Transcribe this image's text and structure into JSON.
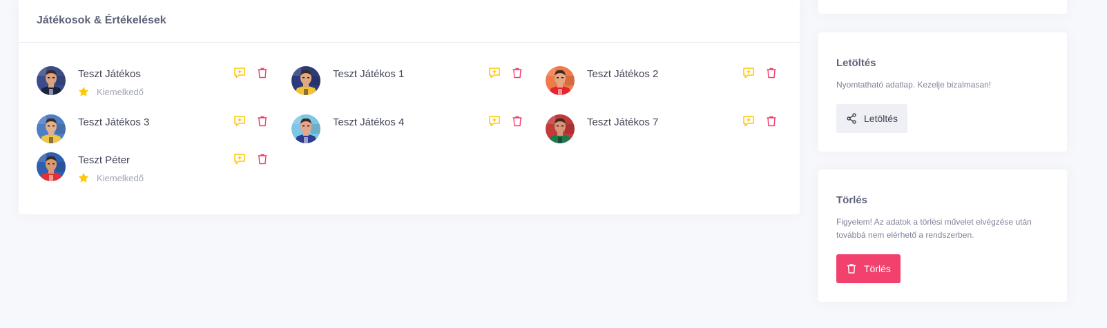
{
  "players_card": {
    "title": "Játékosok & Értékelések"
  },
  "players": [
    {
      "name": "Teszt Játékos",
      "badge": "Kiemelkedő",
      "avatar": "player-avatar-1",
      "shirt": "#1c2340",
      "bg": "#3a4c8a",
      "skin": "#d9a37f"
    },
    {
      "name": "Teszt Játékos 1",
      "badge": "",
      "avatar": "player-avatar-2",
      "shirt": "#f2c431",
      "bg": "#2d3a7a",
      "skin": "#e0a982"
    },
    {
      "name": "Teszt Játékos 2",
      "badge": "",
      "avatar": "player-avatar-3",
      "shirt": "#e4242f",
      "bg": "#f07b4a",
      "skin": "#e6a683"
    },
    {
      "name": "Teszt Játékos 3",
      "badge": "",
      "avatar": "player-avatar-4",
      "shirt": "#f0c64a",
      "bg": "#4e7fc4",
      "skin": "#e0b090"
    },
    {
      "name": "Teszt Játékos 4",
      "badge": "",
      "avatar": "player-avatar-5",
      "shirt": "#2f3c8f",
      "bg": "#7ec7e4",
      "skin": "#e8a58a"
    },
    {
      "name": "Teszt Játékos 7",
      "badge": "",
      "avatar": "player-avatar-6",
      "shirt": "#1f7a4b",
      "bg": "#c33a3a",
      "skin": "#d8957a"
    },
    {
      "name": "Teszt Péter",
      "badge": "Kiemelkedő",
      "avatar": "player-avatar-7",
      "shirt": "#e43035",
      "bg": "#2f5fb0",
      "skin": "#d99a72"
    }
  ],
  "icons": {
    "rate": "comment-plus-icon",
    "delete": "trash-icon",
    "star": "star-icon",
    "share": "share-icon"
  },
  "colors": {
    "rate_icon": "#ffc700",
    "delete_icon": "#f1416c",
    "star": "#ffc700",
    "danger": "#f1416c"
  },
  "download_card": {
    "title": "Letöltés",
    "description": "Nyomtatható adatlap. Kezelje bizalmasan!",
    "button_label": "Letöltés"
  },
  "delete_card": {
    "title": "Törlés",
    "description": "Figyelem! Az adatok a törlési művelet elvégzése után továbbá nem elérhető a rendszerben.",
    "button_label": "Törlés"
  }
}
